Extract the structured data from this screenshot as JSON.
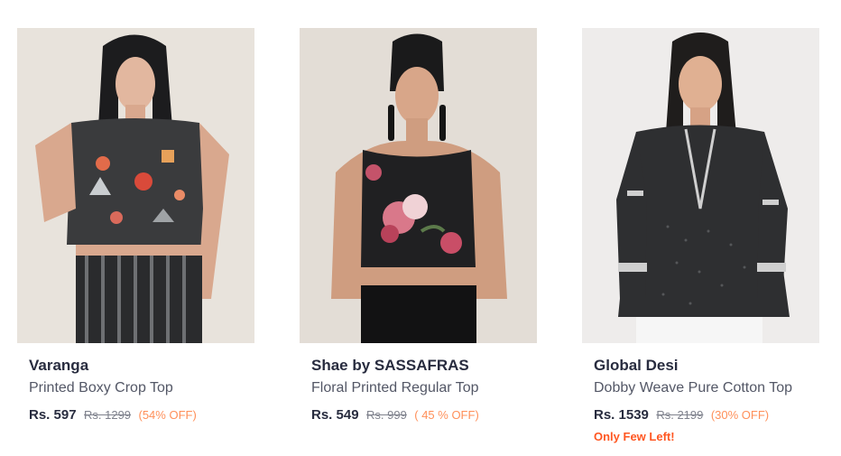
{
  "products": [
    {
      "brand": "Varanga",
      "name": "Printed Boxy Crop Top",
      "price": "Rs. 597",
      "mrp": "Rs. 1299",
      "discount": "(54% OFF)",
      "stock_note": "",
      "image": "model-black-printed-crop-top"
    },
    {
      "brand": "Shae by SASSAFRAS",
      "name": "Floral Printed Regular Top",
      "price": "Rs. 549",
      "mrp": "Rs. 999",
      "discount": "( 45 % OFF)",
      "stock_note": "",
      "image": "model-black-floral-sleeveless-top"
    },
    {
      "brand": "Global Desi",
      "name": "Dobby Weave Pure Cotton Top",
      "price": "Rs. 1539",
      "mrp": "Rs. 2199",
      "discount": "(30% OFF)",
      "stock_note": "Only Few Left!",
      "image": "model-black-dobby-weave-top"
    }
  ],
  "colors": {
    "brand_text": "#282c3f",
    "product_text": "#535766",
    "mrp_text": "#7e818c",
    "discount_text": "#ff905a",
    "stock_text": "#ff5722"
  }
}
